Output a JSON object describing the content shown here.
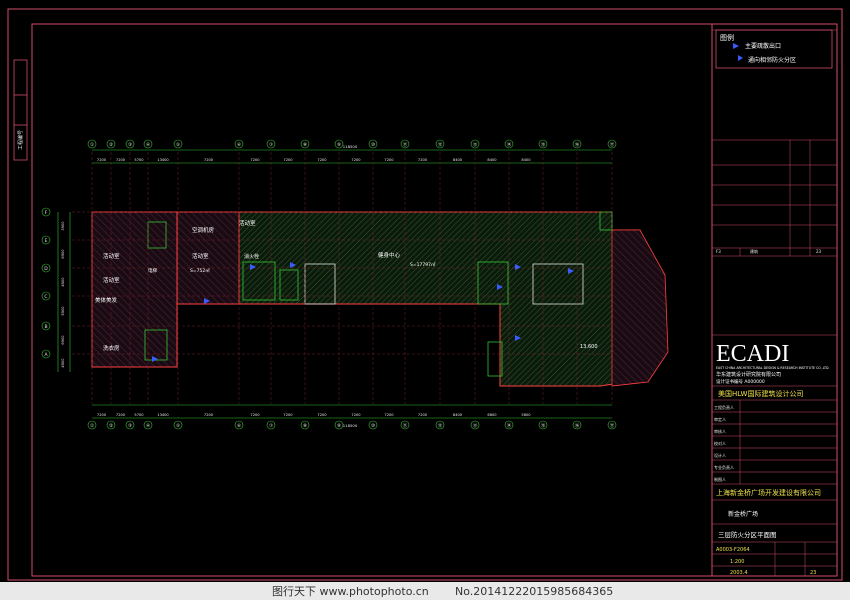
{
  "legend": {
    "title": "图例",
    "items": [
      "主要疏散出口",
      "通向相邻防火分区"
    ]
  },
  "rooms": {
    "activity_room_1": "活动室",
    "activity_room_2": "活动室",
    "aerobics_room": "美体美发",
    "washing_room": "洗衣房",
    "ac_room": "空调机房",
    "activity_room_3": "活动室",
    "activity_room_4": "活动室",
    "fitness_center": "健身中心",
    "fitness_area": "S=17797㎡",
    "room_area_1": "S=752㎡",
    "fire_room": "消火栓",
    "elevator_label": "电梯",
    "right_area": "13,600"
  },
  "dims": {
    "overall": "118500",
    "top": [
      "7200",
      "7200",
      "5700",
      "13400",
      "7200",
      "7200",
      "7200",
      "7200",
      "7200",
      "7200",
      "7200",
      "8400",
      "8400",
      "8400"
    ],
    "bottom": [
      "7200",
      "7200",
      "5700",
      "13400",
      "7200",
      "7200",
      "7200",
      "7200",
      "7200",
      "7200",
      "7200",
      "8400",
      "6800",
      "5800"
    ],
    "bottom_overall": "118500",
    "left": [
      "3900",
      "6900",
      "4500",
      "5500",
      "6900",
      "4500"
    ]
  },
  "axis_top": [
    "①",
    "②",
    "③",
    "④",
    "⑤",
    "⑥",
    "⑦",
    "⑧",
    "⑨",
    "⑩",
    "⑪",
    "⑫",
    "⑬",
    "⑭",
    "⑮",
    "⑯",
    "⑰"
  ],
  "axis_left": [
    "F",
    "E",
    "D",
    "C",
    "B",
    "A"
  ],
  "title_block": {
    "logo": "ECADI",
    "firm_en": "EAST CHINA ARCHITECTURAL DESIGN & RESEARCH INSTITUTE CO.,LTD.",
    "firm_cn": "华东建筑设计研究院有限公司",
    "license": "设计证书编号 A000000",
    "partner": "美国HLW国际建筑设计公司",
    "client": "上海新金桥广场开发建设有限公司",
    "project": "新金桥广场",
    "drawing_title": "三层防火分区平面图",
    "drawing_no": "A0003-F2064",
    "scale": "1:200",
    "date": "2003.4",
    "sheet_no": "23",
    "rows": [
      "工程负责人",
      "审定人",
      "审核人",
      "校对人",
      "设计人",
      "专业负责人",
      "制图人"
    ],
    "right_cols": [
      "F3",
      "建筑",
      "23"
    ]
  },
  "side_stamp": "工程编号",
  "watermark": {
    "left": "图行天下 www.photophoto.cn",
    "right": "No.20141222015985684365"
  }
}
